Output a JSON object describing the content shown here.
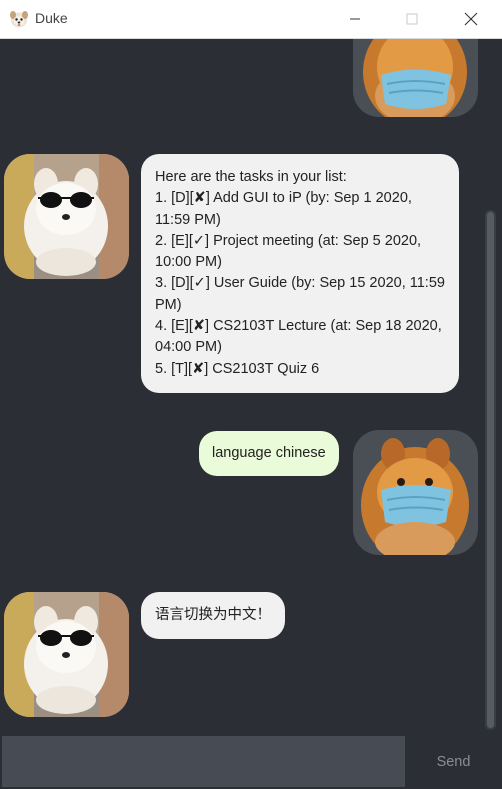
{
  "window": {
    "title": "Duke",
    "icon": "pomeranian-dog-icon"
  },
  "messages": [
    {
      "sender": "user",
      "avatar": "pomeranian-with-mask-avatar",
      "text_lines": []
    },
    {
      "sender": "bot",
      "avatar": "pomeranian-with-sunglasses-avatar",
      "text_lines": [
        "Here are the tasks in your list:",
        "1. [D][✘] Add GUI to iP (by: Sep 1 2020,",
        "11:59 PM)",
        "2. [E][✓] Project meeting (at: Sep 5 2020,",
        "10:00 PM)",
        "3. [D][✓] User Guide (by: Sep 15 2020, 11:59",
        "PM)",
        "4. [E][✘] CS2103T Lecture (at: Sep 18 2020,",
        "04:00 PM)",
        "5. [T][✘] CS2103T Quiz 6"
      ]
    },
    {
      "sender": "user",
      "avatar": "pomeranian-with-mask-avatar",
      "text_lines": [
        "language chinese"
      ]
    },
    {
      "sender": "bot",
      "avatar": "pomeranian-with-sunglasses-avatar",
      "text_lines": [
        "语言切换为中文！"
      ]
    }
  ],
  "input": {
    "value": "",
    "placeholder": ""
  },
  "send_button": {
    "label": "Send"
  },
  "colors": {
    "background": "#2b2e34",
    "bot_bubble": "#f1f1f1",
    "user_bubble": "#eafbd9",
    "input_field": "#474b53",
    "send_text": "#8a8d93"
  }
}
